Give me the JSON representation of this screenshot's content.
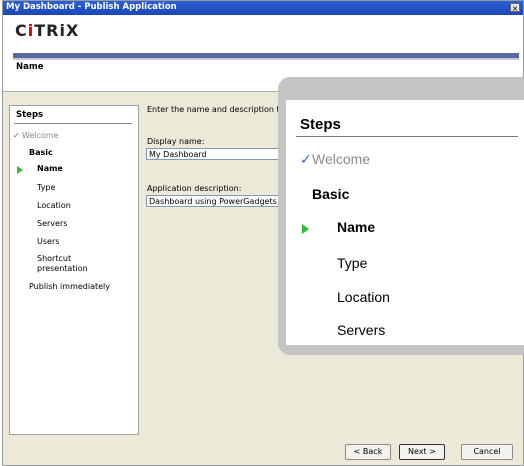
{
  "window": {
    "title": "My Dashboard - Publish Application",
    "close_glyph": "×"
  },
  "brand": {
    "logo_text": "CiTRiX",
    "logo_pre": "C",
    "logo_i1": "i",
    "logo_mid": "TR",
    "logo_i2": "i",
    "logo_post": "X"
  },
  "page_title": "Name",
  "steps": {
    "heading": "Steps",
    "items": [
      {
        "label": "Welcome",
        "state": "done"
      },
      {
        "label": "Basic",
        "state": "section"
      },
      {
        "label": "Name",
        "state": "current"
      },
      {
        "label": "Type",
        "state": "pending"
      },
      {
        "label": "Location",
        "state": "pending"
      },
      {
        "label": "Servers",
        "state": "pending"
      },
      {
        "label": "Users",
        "state": "pending"
      },
      {
        "label": "Shortcut presentation",
        "state": "pending"
      },
      {
        "label": "Publish immediately",
        "state": "pending"
      }
    ],
    "check_glyph": "✓"
  },
  "form": {
    "instruction": "Enter the name and description that you",
    "display_name_label": "Display name:",
    "display_name_value": "My Dashboard",
    "description_label": "Application description:",
    "description_value": "Dashboard using PowerGadgets"
  },
  "buttons": {
    "back": "< Back",
    "next": "Next >",
    "cancel": "Cancel"
  },
  "colors": {
    "title_bar": "#1c47b4",
    "brand_bar": "#5a6aa0",
    "current_arrow": "#2fbf2f",
    "check": "#3a6fd0"
  }
}
